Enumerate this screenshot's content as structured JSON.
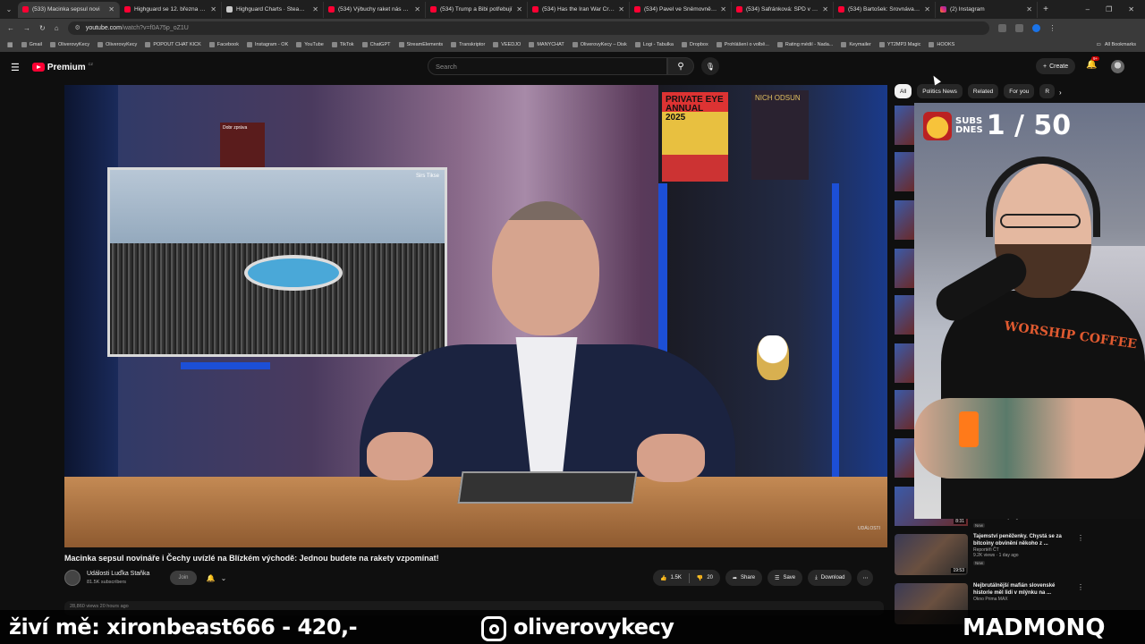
{
  "browser": {
    "tabs": [
      {
        "title": "(533) Macinka sepsul novi",
        "icon": "youtube",
        "active": true
      },
      {
        "title": "Highguard se 12. března defi",
        "icon": "youtube"
      },
      {
        "title": "Highguard Charts · SteamDB",
        "icon": "steam"
      },
      {
        "title": "(534) Výbuchy raket nás budi",
        "icon": "youtube"
      },
      {
        "title": "(534) Trump a Bibi potřebují",
        "icon": "youtube"
      },
      {
        "title": "(534) Has the Iran War Create",
        "icon": "youtube"
      },
      {
        "title": "(534) Pavel ve Sněmovně: Ne",
        "icon": "youtube"
      },
      {
        "title": "(534) Šafránková: SPD v tuto",
        "icon": "youtube"
      },
      {
        "title": "(534) Bartošek: Srovnávat Írán",
        "icon": "youtube"
      },
      {
        "title": "(2) Instagram",
        "icon": "instagram"
      }
    ],
    "url_host": "youtube.com",
    "url_path": "/watch?v=f0A75p_oZ1U",
    "bookmarks": [
      "Gmail",
      "OliverovyKecy",
      "OliverovyKecy",
      "POPOUT CHAT KICK",
      "Facebook",
      "Instagram - OK",
      "YouTube",
      "TikTok",
      "ChatGPT",
      "StreamElements",
      "Transkriptor",
      "VEEDJO",
      "MANYCHAT",
      "OliverovyKecy – Disk",
      "Logi - Tabulka",
      "Dropbox",
      "Prohlášení o volbě...",
      "Rating médií - Nada...",
      "Keymailer",
      "YT2MP3 Magic",
      "HOOKS"
    ],
    "all_bookmarks": "All Bookmarks"
  },
  "youtube": {
    "logo_text": "Premium",
    "country": "CZ",
    "search_placeholder": "Search",
    "create_label": "Create",
    "notif_count": "9+"
  },
  "video": {
    "title": "Macinka sepsul novináře i Čechy uvízlé na Blízkém východě: Jednou budete na rakety vzpomínat!",
    "channel": "Události Luďka Staňka",
    "subscribers": "81.5K subscribers",
    "join_label": "Join",
    "likes": "1.5K",
    "dislikes": "20",
    "share_label": "Share",
    "save_label": "Save",
    "download_label": "Download",
    "desc_stub": "28,860 views  20 hours ago",
    "tv_tag": "Sirs Tikse",
    "book_title": "PRIVATE EYE ANNUAL 2025",
    "book2_title": "NICH ODSUN",
    "red_book": "Dobr zpráva",
    "watermark": "UDÁLOSTI"
  },
  "chips": [
    "All",
    "Politics News",
    "Related",
    "For you",
    "R"
  ],
  "recommendations": [
    {
      "title": "Tajemství peněženky. Chystá se za bitcoiny obvinění někoho z ...",
      "channel": "Reportéři ČT",
      "meta": "9.2K views · 1 day ago",
      "badge": "New",
      "duration": "19:53"
    },
    {
      "title": "Nejbrutálnější mafián slovenské historie měl lidi v mlýnku na ...",
      "channel": "Okno Prima MAX",
      "meta": "",
      "badge": "",
      "duration": ""
    }
  ],
  "prev_rec": {
    "duration": "8:31",
    "badge": "New",
    "meta": "1.8K views · 2 days ago"
  },
  "overlay": {
    "subs_label_1": "SUBS",
    "subs_label_2": "DNES",
    "subs_count": "1 / 50",
    "shirt_text": "WORSHIP COFFEE"
  },
  "banner": {
    "left": "živí mě: xironbeast666 - 420,-",
    "middle": "oliverovykecy",
    "right": "MADMONQ"
  }
}
